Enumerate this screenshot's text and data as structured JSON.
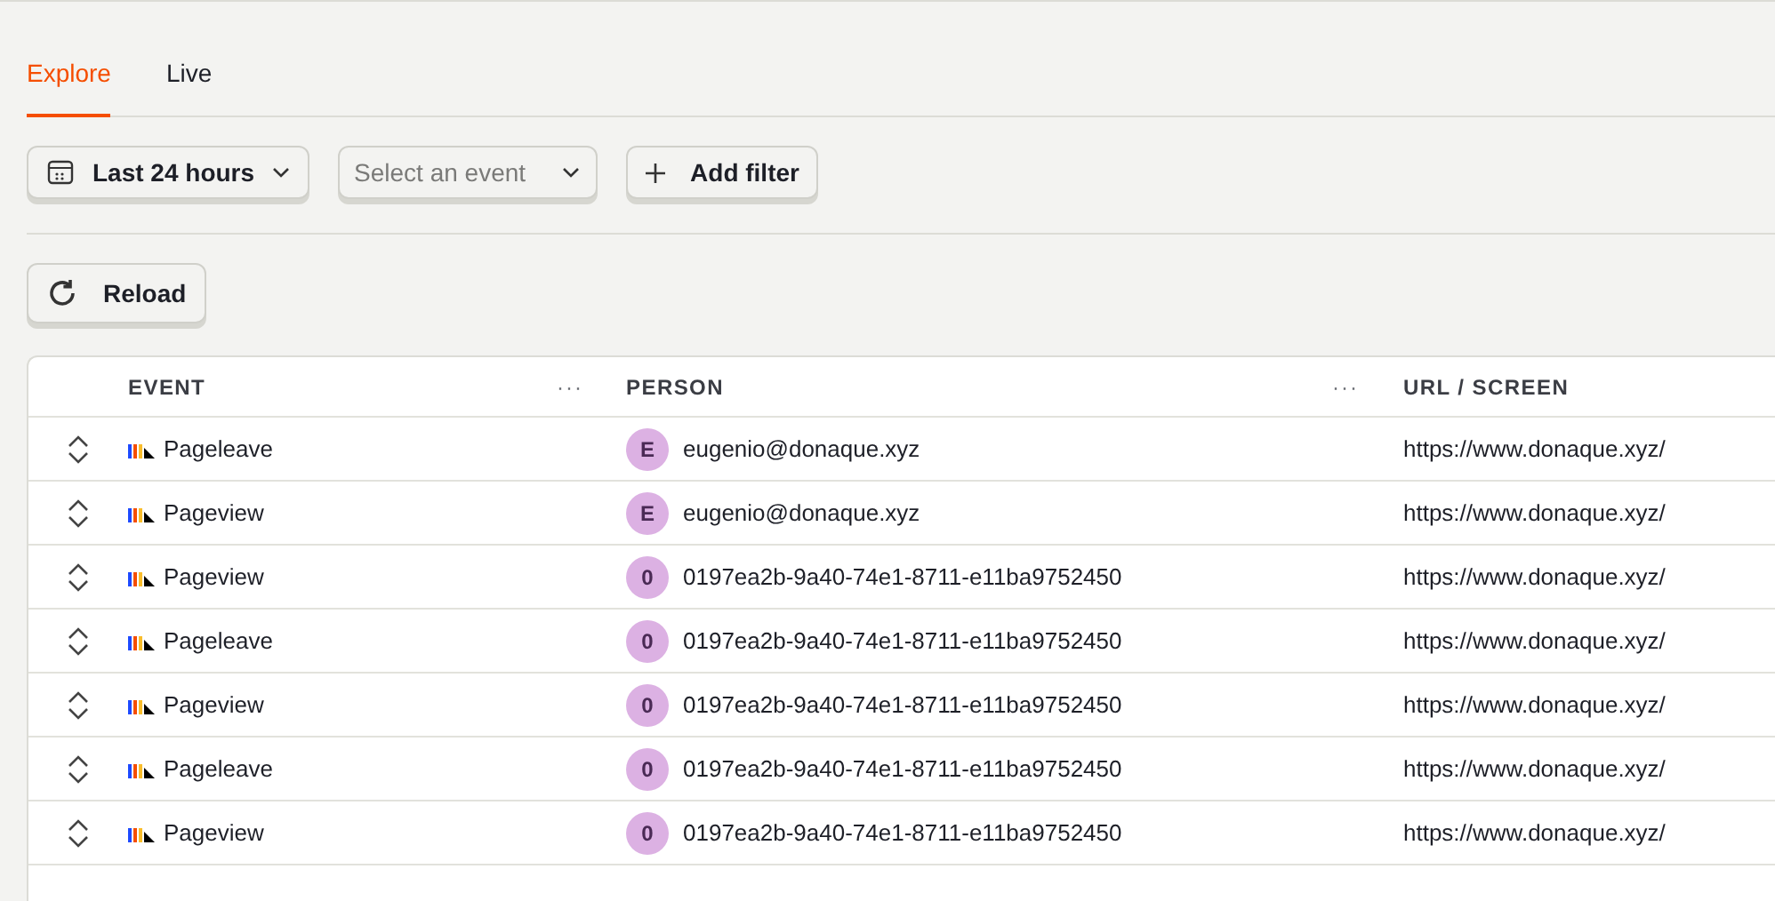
{
  "tabs": [
    {
      "label": "Explore",
      "selected": true
    },
    {
      "label": "Live",
      "selected": false
    }
  ],
  "filters": {
    "date_range": "Last 24 hours",
    "event_select": {
      "placeholder": "Select an event"
    },
    "add_filter": "Add filter"
  },
  "reload_button": "Reload",
  "table": {
    "columns": [
      {
        "label": "EVENT",
        "menu": "···"
      },
      {
        "label": "PERSON",
        "menu": "···"
      },
      {
        "label": "URL / SCREEN"
      }
    ],
    "rows": [
      {
        "event": "Pageleave",
        "avatar": "E",
        "person": "eugenio@donaque.xyz",
        "url": "https://www.donaque.xyz/"
      },
      {
        "event": "Pageview",
        "avatar": "E",
        "person": "eugenio@donaque.xyz",
        "url": "https://www.donaque.xyz/"
      },
      {
        "event": "Pageview",
        "avatar": "0",
        "person": "0197ea2b-9a40-74e1-8711-e11ba9752450",
        "url": "https://www.donaque.xyz/"
      },
      {
        "event": "Pageleave",
        "avatar": "0",
        "person": "0197ea2b-9a40-74e1-8711-e11ba9752450",
        "url": "https://www.donaque.xyz/"
      },
      {
        "event": "Pageview",
        "avatar": "0",
        "person": "0197ea2b-9a40-74e1-8711-e11ba9752450",
        "url": "https://www.donaque.xyz/"
      },
      {
        "event": "Pageleave",
        "avatar": "0",
        "person": "0197ea2b-9a40-74e1-8711-e11ba9752450",
        "url": "https://www.donaque.xyz/"
      },
      {
        "event": "Pageview",
        "avatar": "0",
        "person": "0197ea2b-9a40-74e1-8711-e11ba9752450",
        "url": "https://www.donaque.xyz/"
      }
    ]
  }
}
